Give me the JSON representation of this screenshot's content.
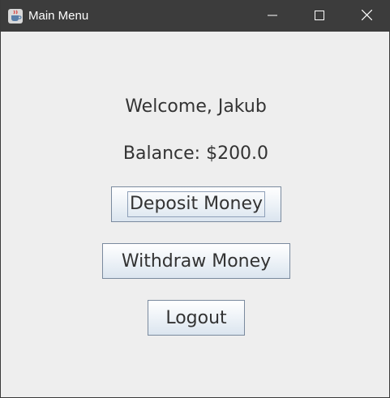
{
  "window": {
    "title": "Main Menu",
    "app_icon": "java-cup-icon",
    "controls": {
      "minimize_icon": "minimize-icon",
      "maximize_icon": "maximize-icon",
      "close_icon": "close-icon"
    }
  },
  "main": {
    "welcome_text": "Welcome, Jakub",
    "balance_text": "Balance: $200.0",
    "buttons": {
      "deposit_label": "Deposit Money",
      "withdraw_label": "Withdraw Money",
      "logout_label": "Logout"
    },
    "focused_button": "deposit"
  },
  "colors": {
    "titlebar_bg": "#3c3c3c",
    "window_bg": "#eeeeee",
    "text": "#333333",
    "button_border": "#7a8a9e"
  }
}
